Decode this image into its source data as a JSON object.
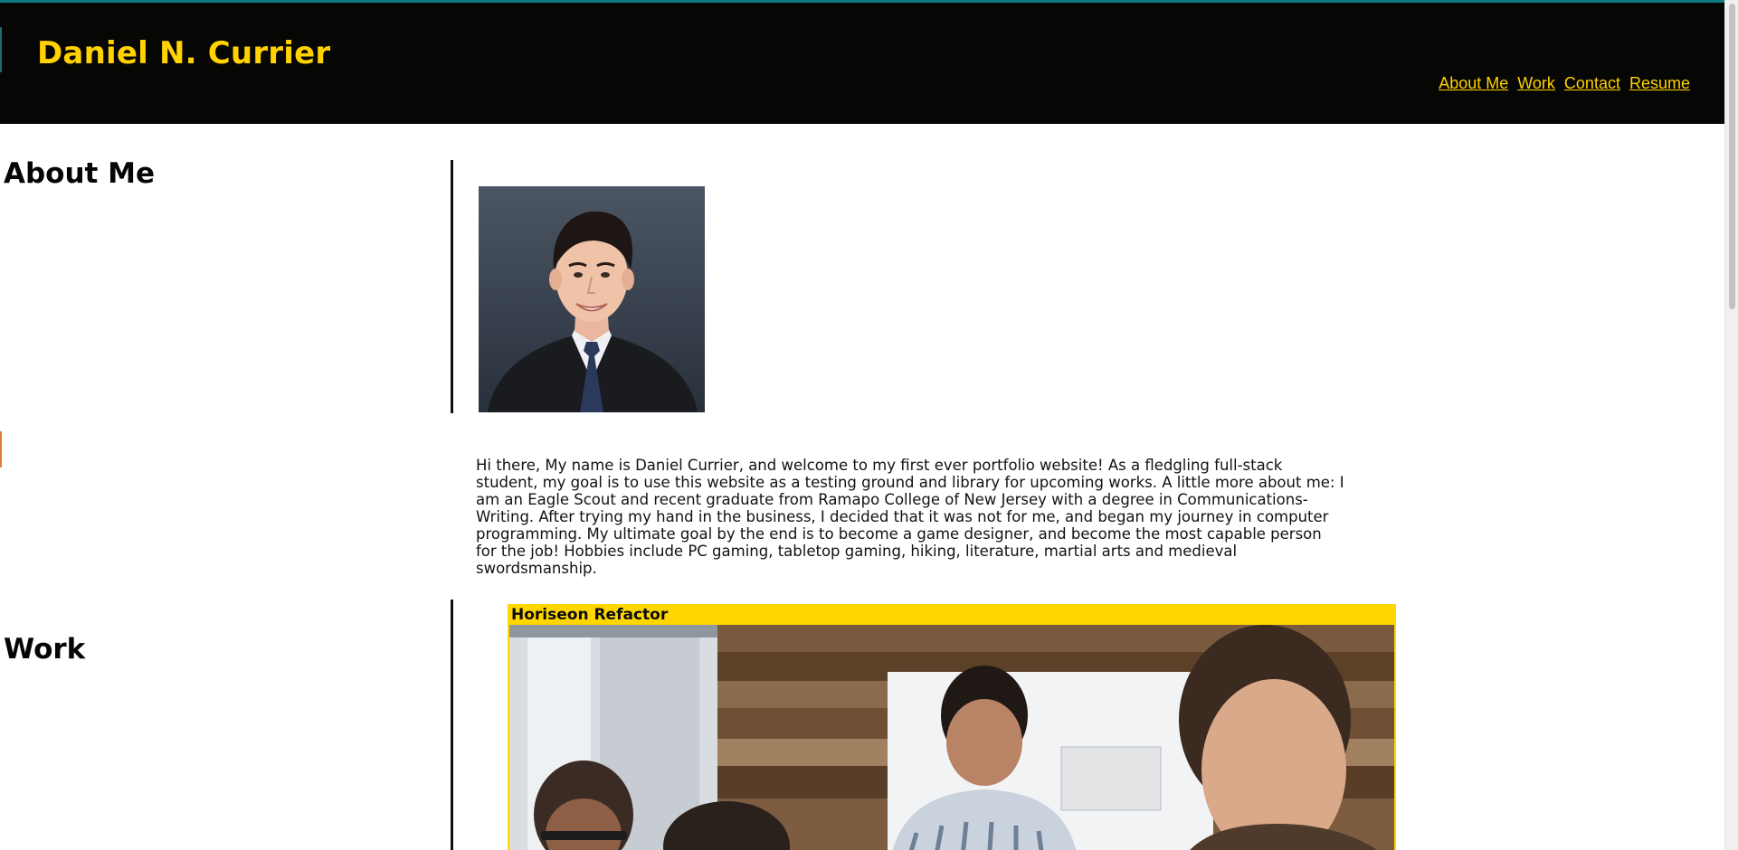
{
  "header": {
    "title": "Daniel N. Currier",
    "nav": [
      "About Me",
      "Work",
      "Contact",
      "Resume"
    ]
  },
  "about": {
    "heading": "About Me",
    "bio": "Hi there, My name is Daniel Currier, and welcome to my first ever portfolio website! As a fledgling full-stack student, my goal is to use this website as a testing ground and library for upcoming works. A little more about me: I am an Eagle Scout and recent graduate from Ramapo College of New Jersey with a degree in Communications-Writing. After trying my hand in the business, I decided that it was not for me, and began my journey in computer programming. My ultimate goal by the end is to become a game designer, and become the most capable person for the job! Hobbies include PC gaming, tabletop gaming, hiking, literature, martial arts and medieval swordsmanship."
  },
  "work": {
    "heading": "Work",
    "projects": [
      {
        "title": "Horiseon Refactor"
      }
    ]
  },
  "colors": {
    "header_bg": "#060604",
    "accent": "#ffd200",
    "header_border": "#0f7a80",
    "card_bg": "#ffd600"
  }
}
